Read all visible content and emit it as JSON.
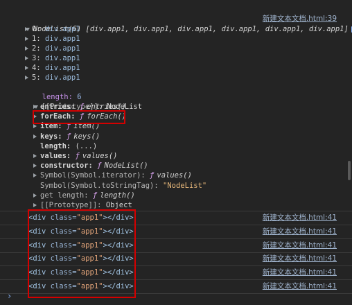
{
  "source_link": "新建文本文档.html:39",
  "nodelist": {
    "summary": "NodeList(6) [div.app1, div.app1, div.app1, div.app1, div.app1, div.app1]",
    "info_badge": "i",
    "items": [
      {
        "index": "0:",
        "value": "div.app1"
      },
      {
        "index": "1:",
        "value": "div.app1"
      },
      {
        "index": "2:",
        "value": "div.app1"
      },
      {
        "index": "3:",
        "value": "div.app1"
      },
      {
        "index": "4:",
        "value": "div.app1"
      },
      {
        "index": "5:",
        "value": "div.app1"
      }
    ],
    "length_label": "length:",
    "length_value": "6",
    "prototype_label": "[[Prototype]]:",
    "prototype_value": "NodeList",
    "proto_members": [
      {
        "key": "entries:",
        "fsym": "ƒ",
        "value": "entries()",
        "expandable": true
      },
      {
        "key": "forEach:",
        "fsym": "ƒ",
        "value": "forEach()",
        "expandable": true
      },
      {
        "key": "item:",
        "fsym": "ƒ",
        "value": "item()",
        "expandable": true
      },
      {
        "key": "keys:",
        "fsym": "ƒ",
        "value": "keys()",
        "expandable": true
      },
      {
        "key": "length:",
        "fsym": "",
        "value": "(...)",
        "expandable": false
      },
      {
        "key": "values:",
        "fsym": "ƒ",
        "value": "values()",
        "expandable": true
      },
      {
        "key": "constructor:",
        "fsym": "ƒ",
        "value": "NodeList()",
        "expandable": true
      },
      {
        "key": "Symbol(Symbol.iterator):",
        "fsym": "ƒ",
        "value": "values()",
        "expandable": true
      },
      {
        "key": "Symbol(Symbol.toStringTag):",
        "fsym": "",
        "value": "\"NodeList\"",
        "expandable": false
      },
      {
        "key": "get length:",
        "fsym": "ƒ",
        "value": "length()",
        "expandable": true
      },
      {
        "key": "[[Prototype]]:",
        "fsym": "",
        "value": "Object",
        "expandable": true
      }
    ]
  },
  "logged_elements": [
    {
      "open": "<div",
      "attr": "class=",
      "val": "\"app1\"",
      "close": "></div>",
      "link": "新建文本文档.html:41"
    },
    {
      "open": "<div",
      "attr": "class=",
      "val": "\"app1\"",
      "close": "></div>",
      "link": "新建文本文档.html:41"
    },
    {
      "open": "<div",
      "attr": "class=",
      "val": "\"app1\"",
      "close": "></div>",
      "link": "新建文本文档.html:41"
    },
    {
      "open": "<div",
      "attr": "class=",
      "val": "\"app1\"",
      "close": "></div>",
      "link": "新建文本文档.html:41"
    },
    {
      "open": "<div",
      "attr": "class=",
      "val": "\"app1\"",
      "close": "></div>",
      "link": "新建文本文档.html:41"
    },
    {
      "open": "<div",
      "attr": "class=",
      "val": "\"app1\"",
      "close": "></div>",
      "link": "新建文本文档.html:41"
    }
  ],
  "prompt_symbol": "›",
  "colors": {
    "background": "#242424",
    "link": "#9fb3cd",
    "highlight_box": "#d40000",
    "prompt": "#8ab4f8"
  }
}
